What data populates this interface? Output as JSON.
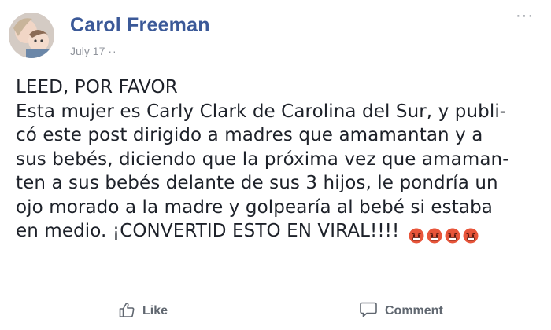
{
  "post": {
    "author": "Carol Freeman",
    "date": "July 17",
    "date_suffix": "··",
    "more_label": "···",
    "text_lines": [
      "LEED, POR FAVOR",
      "Esta mujer es Carly Clark de Carolina del Sur, y publi-",
      "có este post dirigido a madres que amamantan y a",
      "sus bebés, diciendo que la próxima vez que amaman-",
      "ten a sus bebés delante de sus 3 hijos, le pondría un",
      "ojo morado a la madre y golpearía al bebé si estaba",
      "en medio. ¡CONVERTID ESTO EN VIRAL!!!!"
    ],
    "emoji_icons": [
      "angry-face-icon",
      "angry-face-icon",
      "angry-face-icon",
      "angry-face-icon"
    ]
  },
  "actions": {
    "like_label": "Like",
    "comment_label": "Comment"
  },
  "colors": {
    "author": "#3b5998",
    "meta": "#90949c",
    "text": "#1d2129",
    "action": "#606770",
    "divider": "#dadde1",
    "emoji": "#e8553a"
  }
}
